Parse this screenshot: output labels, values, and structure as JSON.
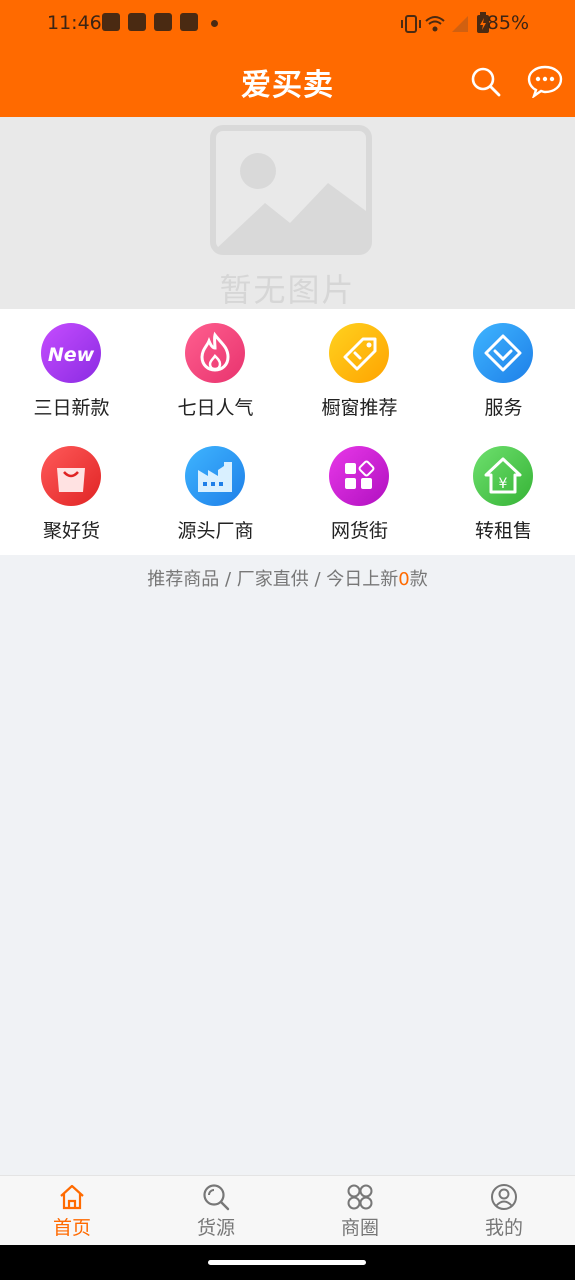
{
  "status_bar": {
    "time": "11:46",
    "battery": "85%",
    "icons": [
      "bag-notification-icon",
      "bag-notification-icon",
      "bag-notification-icon",
      "bag-notification-icon",
      "dot-icon",
      "vibrate-icon",
      "wifi-icon",
      "signal-icon",
      "battery-icon"
    ]
  },
  "app_bar": {
    "title": "爱买卖",
    "icons": [
      "search-icon",
      "message-icon"
    ]
  },
  "banner": {
    "placeholder_text": "暂无图片",
    "icon": "image-placeholder-icon"
  },
  "categories": [
    {
      "label": "三日新款",
      "icon": "new-icon",
      "color": "#b03df0"
    },
    {
      "label": "七日人气",
      "icon": "fire-icon",
      "color": "#f0477a"
    },
    {
      "label": "橱窗推荐",
      "icon": "tag-icon",
      "color": "#ffb700"
    },
    {
      "label": "服务",
      "icon": "diamond-icon",
      "color": "#2196f3"
    },
    {
      "label": "聚好货",
      "icon": "shopping-bag-icon",
      "color": "#f23d3d"
    },
    {
      "label": "源头厂商",
      "icon": "factory-icon",
      "color": "#2196f3"
    },
    {
      "label": "网货街",
      "icon": "apps-icon",
      "color": "#d41ad4"
    },
    {
      "label": "转租售",
      "icon": "house-yen-icon",
      "color": "#4cc94c"
    }
  ],
  "recommend": {
    "prefix": "推荐商品 / 厂家直供 / 今日上新",
    "count": "0",
    "suffix": "款"
  },
  "tabs": [
    {
      "label": "首页",
      "icon": "home-icon",
      "active": true
    },
    {
      "label": "货源",
      "icon": "search-source-icon",
      "active": false
    },
    {
      "label": "商圈",
      "icon": "circles-icon",
      "active": false
    },
    {
      "label": "我的",
      "icon": "profile-icon",
      "active": false
    }
  ],
  "colors": {
    "brand": "#ff6a00",
    "active_tab": "#ff6a00",
    "inactive_tab": "#777777"
  }
}
